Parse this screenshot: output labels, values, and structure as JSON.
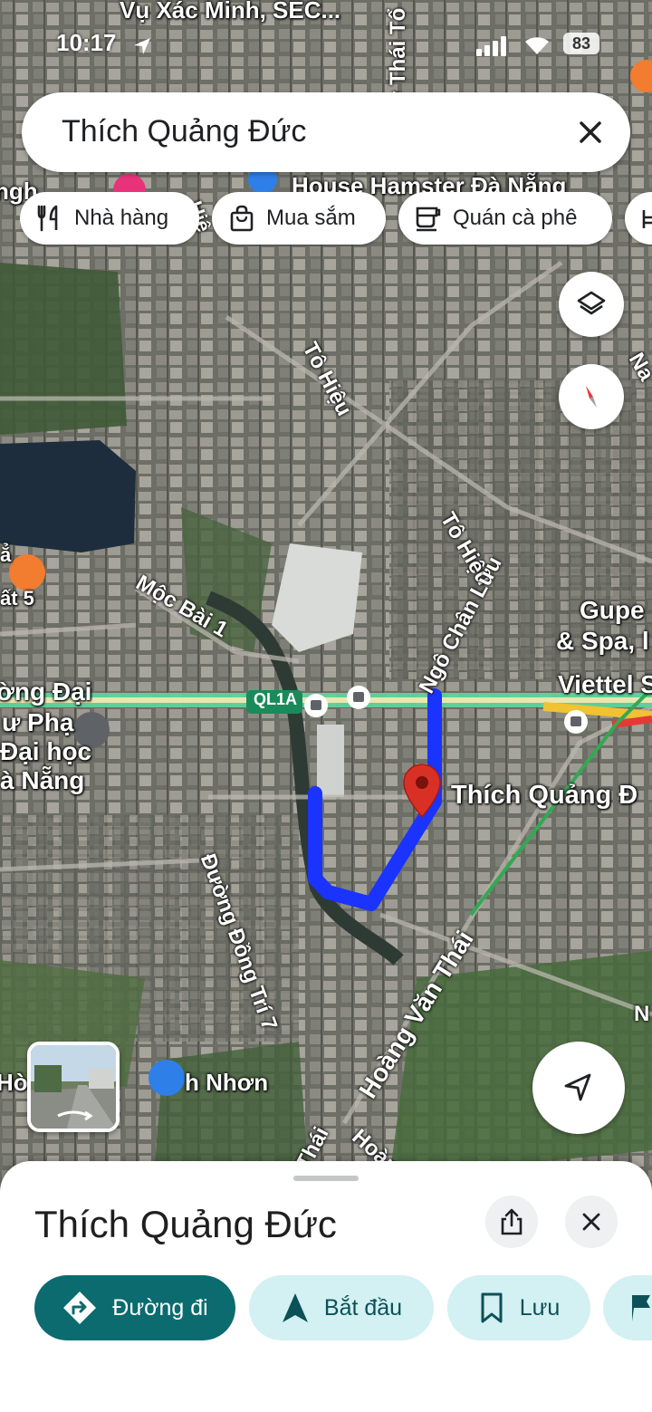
{
  "status_bar": {
    "time": "10:17",
    "battery": "83"
  },
  "search": {
    "query": "Thích Quảng Đức"
  },
  "chips": [
    {
      "label": "Nhà hàng",
      "icon": "restaurant-icon"
    },
    {
      "label": "Mua sắm",
      "icon": "shopping-bag-icon"
    },
    {
      "label": "Quán cà phê",
      "icon": "coffee-icon"
    }
  ],
  "map": {
    "place_labels": {
      "top": "Vụ Xác Minh, SEC...",
      "house_hamster": "House Hamster Đà Nẵng",
      "gupe": "Gupe",
      "spa": "& Spa, l",
      "viettel": "Viettel S",
      "university_1": "ờng Đại",
      "university_2": "ư Phạ",
      "university_3": "Đại học",
      "university_4": "à Nẵng",
      "pin_label": "Thích Quảng Đ",
      "bottom_left": "Hò",
      "bottom_mid": "h Nhơn",
      "left_food_1": "ẳ",
      "left_food_2": "ất 5",
      "top_left": "ngh"
    },
    "road_labels": {
      "thai_to": "y Thái Tổ",
      "hieu_top": "Hiệ",
      "to_hieu_1": "Tô Hiệu",
      "to_hieu_2": "Tô Hiệu",
      "ngo_chan_luu": "Ngô Chân Lưu",
      "moc_bai": "Mộc Bài 1",
      "ql1a": "QL1A",
      "dong_tri": "Đường Đồng Trí 7",
      "hoang_van_thai": "Hoàng Văn Thái",
      "thai_bottom": "Thái",
      "hoan_bottom": "Hoàn",
      "right_na": "Na",
      "right_n": "N"
    },
    "route_color": "#1a33ff",
    "pin_color": "#d93025"
  },
  "sheet": {
    "title": "Thích Quảng Đức",
    "actions": [
      {
        "label": "Đường đi",
        "icon": "directions-icon"
      },
      {
        "label": "Bắt đầu",
        "icon": "navigation-arrow-icon"
      },
      {
        "label": "Lưu",
        "icon": "bookmark-icon"
      }
    ]
  }
}
